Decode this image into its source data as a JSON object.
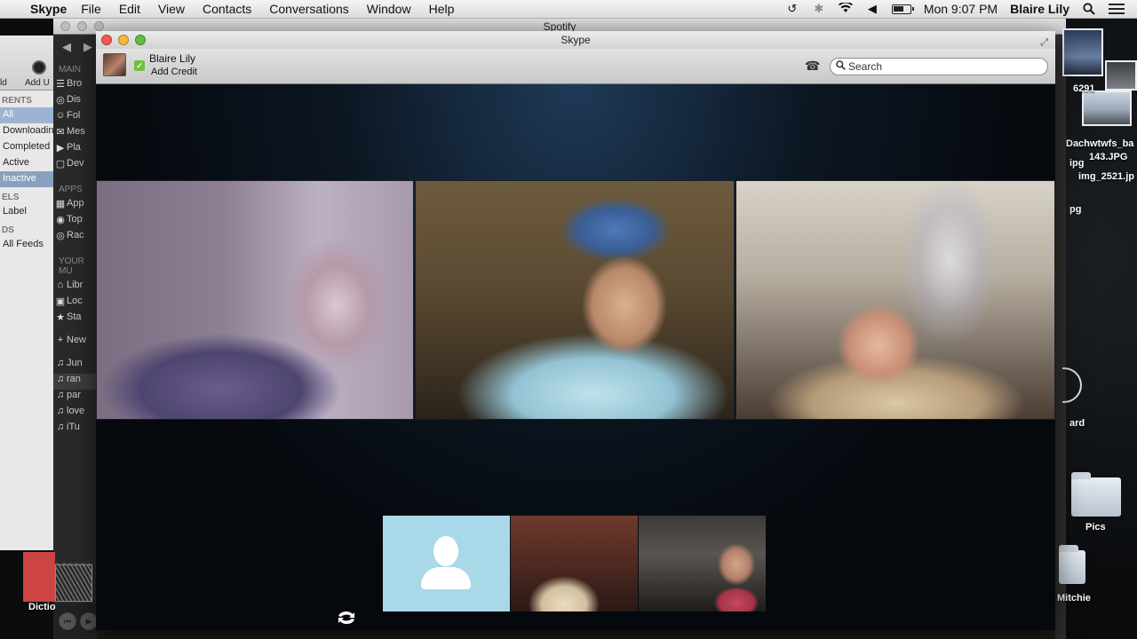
{
  "menubar": {
    "app_name": "Skype",
    "menus": [
      "File",
      "Edit",
      "View",
      "Contacts",
      "Conversations",
      "Window",
      "Help"
    ],
    "clock": "Mon 9:07 PM",
    "user": "Blaire Lily",
    "icons": [
      "time-machine-icon",
      "bluetooth-icon",
      "wifi-icon",
      "volume-icon",
      "battery-icon",
      "spotlight-search-icon",
      "notification-menu-icon"
    ]
  },
  "bg_left_window": {
    "toolbar_labels": [
      "ld",
      "Add U"
    ],
    "section_torrents": "RENTS",
    "items": [
      "All",
      "Downloadin",
      "Completed",
      "Active",
      "Inactive"
    ],
    "section_labels": "ELS",
    "label_item": "Label",
    "section_feeds": "DS",
    "feeds_item": "All Feeds"
  },
  "spotify": {
    "title": "Spotify",
    "section_main": "MAIN",
    "main_items": [
      "Bro",
      "Dis",
      "Fol",
      "Mes",
      "Pla",
      "Dev"
    ],
    "section_apps": "APPS",
    "app_items": [
      "App",
      "Top",
      "Rac"
    ],
    "section_music": "YOUR MU",
    "music_items": [
      "Libr",
      "Loc",
      "Sta"
    ],
    "new_item": "New",
    "playlists": [
      "Jun",
      "ran",
      "par",
      "love",
      "iTu"
    ]
  },
  "skype": {
    "title": "Skype",
    "user_name": "Blaire Lily",
    "add_credit": "Add Credit",
    "search_placeholder": "Search"
  },
  "desktop": {
    "labels": {
      "top_number": "6291",
      "file1_line1": "Dachwtwfs_ba",
      "file1_line2": "143.JPG",
      "file2": "img_2521.jp",
      "ipg": "ipg",
      "pg": "pg",
      "ard": "ard",
      "pics": "Pics",
      "mitchie": "Mitchie",
      "diction": "Dictio"
    }
  },
  "colors": {
    "skype_call_bg": "#05080c",
    "status_green": "#6fc23e",
    "placeholder_blue": "#a9d8e8"
  }
}
